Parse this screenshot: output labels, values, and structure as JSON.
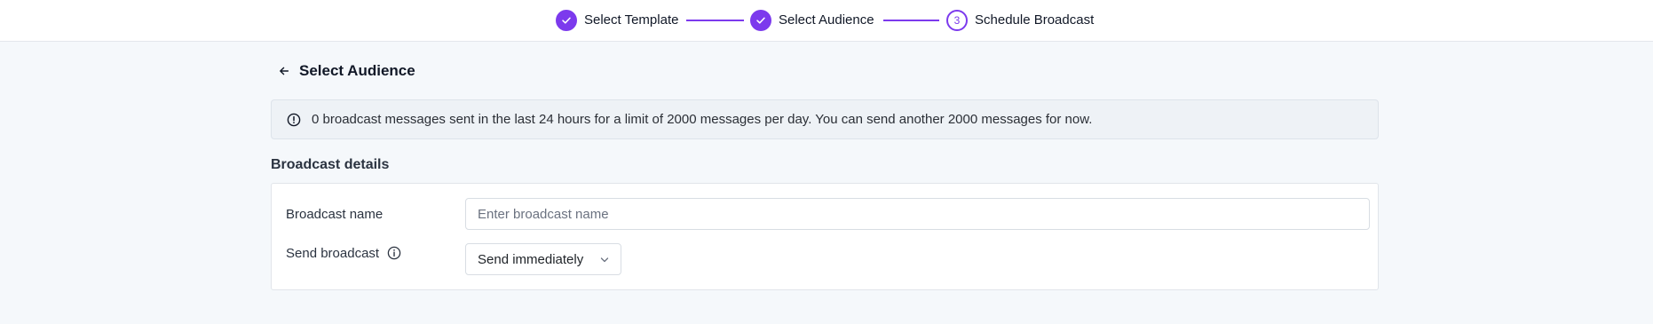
{
  "stepper": {
    "steps": [
      {
        "label": "Select Template",
        "status": "done",
        "icon": "check-icon"
      },
      {
        "label": "Select Audience",
        "status": "done",
        "icon": "check-icon"
      },
      {
        "label": "Schedule Broadcast",
        "status": "current",
        "number": "3"
      }
    ],
    "accent_color": "#7c3aed"
  },
  "header": {
    "back_icon": "arrow-left-icon",
    "title": "Select Audience"
  },
  "info_banner": {
    "icon": "alert-circle-icon",
    "text": "0 broadcast messages sent in the last 24 hours for a limit of 2000 messages per day. You can send another 2000 messages for now."
  },
  "broadcast_details": {
    "section_title": "Broadcast details",
    "name_field": {
      "label": "Broadcast name",
      "placeholder": "Enter broadcast name",
      "value": ""
    },
    "send_field": {
      "label": "Send broadcast",
      "info_icon": "info-icon",
      "selected": "Send immediately",
      "chevron_icon": "chevron-down-icon"
    }
  }
}
